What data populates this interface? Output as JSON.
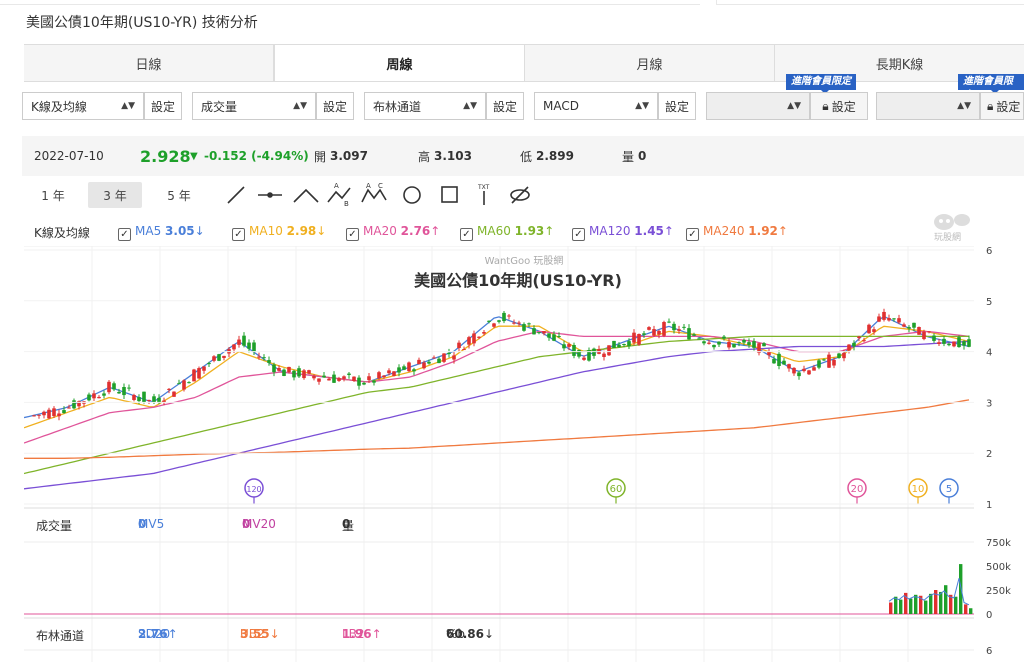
{
  "page_title": "美國公債10年期(US10-YR) 技術分析",
  "tabs": [
    {
      "label": "日線",
      "active": false
    },
    {
      "label": "周線",
      "active": true
    },
    {
      "label": "月線",
      "active": false
    },
    {
      "label": "長期K線",
      "active": false
    }
  ],
  "selectors": {
    "main_indicator": "K線及均線",
    "volume": "成交量",
    "bollinger": "布林通道",
    "macd": "MACD",
    "set_label": "設定",
    "vip_label": "進階會員限定"
  },
  "quote": {
    "date": "2022-07-10",
    "price": "2.928",
    "arrow": "▼",
    "change": "-0.152 (-4.94%)",
    "open_label": "開",
    "open": "3.097",
    "high_label": "高",
    "high": "3.103",
    "low_label": "低",
    "low": "2.899",
    "vol_label": "量",
    "vol": "0"
  },
  "ranges": [
    {
      "label": "1 年",
      "active": false
    },
    {
      "label": "3 年",
      "active": true
    },
    {
      "label": "5 年",
      "active": false
    }
  ],
  "tool_icons": [
    "trend-line-icon",
    "horizontal-line-icon",
    "angle-icon",
    "abcd-pattern-icon",
    "xabcd-pattern-icon",
    "circle-icon",
    "rectangle-icon",
    "text-icon",
    "hide-icon"
  ],
  "ma_legend": {
    "label": "K線及均線",
    "items": [
      {
        "name": "MA5",
        "value": "3.05",
        "arrow": "↓",
        "color": "#4a7fd9"
      },
      {
        "name": "MA10",
        "value": "2.98",
        "arrow": "↓",
        "color": "#f0b020"
      },
      {
        "name": "MA20",
        "value": "2.76",
        "arrow": "↑",
        "color": "#e0559a"
      },
      {
        "name": "MA60",
        "value": "1.93",
        "arrow": "↑",
        "color": "#7fb42a"
      },
      {
        "name": "MA120",
        "value": "1.45",
        "arrow": "↑",
        "color": "#7a4fd6"
      },
      {
        "name": "MA240",
        "value": "1.92",
        "arrow": "↑",
        "color": "#f07a40"
      }
    ]
  },
  "chart_watermark": "WantGoo 玩股網",
  "chart_title": "美國公債10年期(US10-YR)",
  "logo_text": "玩股網",
  "price_axis": [
    "6",
    "5",
    "4",
    "3",
    "2",
    "1"
  ],
  "ma_markers": [
    {
      "label": "120",
      "color": "#7a4fd6",
      "x": "2019-10"
    },
    {
      "label": "60",
      "color": "#7fb42a",
      "x": "2020-12"
    },
    {
      "label": "20",
      "color": "#e0559a",
      "x": "2021-11"
    },
    {
      "label": "10",
      "color": "#f0b020",
      "x": "2022-05"
    },
    {
      "label": "5",
      "color": "#4a7fd9",
      "x": "2022-06"
    }
  ],
  "volume_legend": {
    "label": "成交量",
    "mv5_label": "MV5",
    "mv5": "0",
    "mv20_label": "MV20",
    "mv20": "0",
    "vol_label": "量",
    "vol": "0"
  },
  "volume_axis": [
    "750k",
    "500k",
    "250k",
    "0"
  ],
  "boll_legend": {
    "label": "布林通道",
    "sd_label": "SD20",
    "sd": "2.76",
    "sd_arrow": "↑",
    "ub_label": "UB2",
    "ub": "3.55",
    "ub_arrow": "↓",
    "lb_label": "LB2",
    "lb": "1.96",
    "lb_arrow": "↑",
    "pb_label": "%b",
    "pb": "60.86",
    "pb_arrow": "↓"
  },
  "boll_axis_top": "6",
  "colors": {
    "up": "#e03030",
    "down": "#1ea02a",
    "accent": "#2962c4"
  },
  "chart_data": {
    "type": "line",
    "title": "美國公債10年期(US10-YR)",
    "ylim": [
      1,
      6
    ],
    "series": [
      {
        "name": "MA5",
        "values": [
          2.7,
          2.9,
          3.3,
          3.0,
          3.6,
          4.2,
          3.6,
          3.5,
          3.4,
          3.7,
          4.0,
          4.7,
          4.4,
          3.9,
          4.2,
          4.5,
          4.2,
          4.1,
          3.6,
          3.9,
          4.7,
          4.3,
          4.1
        ]
      },
      {
        "name": "MA10",
        "values": [
          2.5,
          2.8,
          3.1,
          2.9,
          3.4,
          4.0,
          3.7,
          3.5,
          3.4,
          3.6,
          3.9,
          4.5,
          4.5,
          4.0,
          4.1,
          4.4,
          4.3,
          4.1,
          3.8,
          3.9,
          4.5,
          4.4,
          4.2
        ]
      },
      {
        "name": "MA20",
        "values": [
          2.2,
          2.5,
          2.8,
          2.9,
          3.1,
          3.5,
          3.6,
          3.5,
          3.4,
          3.5,
          3.8,
          4.2,
          4.4,
          4.3,
          4.3,
          4.3,
          4.3,
          4.2,
          4.0,
          4.0,
          4.3,
          4.4,
          4.3
        ]
      },
      {
        "name": "MA60",
        "values": [
          1.6,
          1.8,
          2.0,
          2.2,
          2.4,
          2.6,
          2.8,
          3.0,
          3.2,
          3.3,
          3.5,
          3.7,
          3.9,
          4.0,
          4.1,
          4.2,
          4.25,
          4.3,
          4.3,
          4.3,
          4.3,
          4.3,
          4.3
        ]
      },
      {
        "name": "MA120",
        "values": [
          1.3,
          1.4,
          1.5,
          1.6,
          1.8,
          2.0,
          2.2,
          2.4,
          2.6,
          2.8,
          3.0,
          3.2,
          3.4,
          3.6,
          3.75,
          3.9,
          4.0,
          4.05,
          4.1,
          4.1,
          4.1,
          4.15,
          4.2
        ]
      },
      {
        "name": "MA240",
        "values": [
          1.9,
          1.9,
          1.92,
          1.95,
          1.98,
          2.0,
          2.02,
          2.05,
          2.08,
          2.1,
          2.15,
          2.2,
          2.25,
          2.3,
          2.35,
          2.4,
          2.45,
          2.5,
          2.6,
          2.7,
          2.8,
          2.9,
          3.05
        ]
      }
    ],
    "volume_values": [
      0,
      0,
      0,
      0,
      0,
      0,
      0,
      0,
      0,
      0,
      0,
      0,
      0,
      0,
      0,
      0,
      0,
      0,
      0,
      0,
      0,
      120000,
      180000,
      150000,
      220000,
      160000,
      200000,
      190000,
      140000,
      210000,
      250000,
      230000,
      300000,
      200000,
      180000,
      520000,
      100000,
      60000
    ]
  }
}
